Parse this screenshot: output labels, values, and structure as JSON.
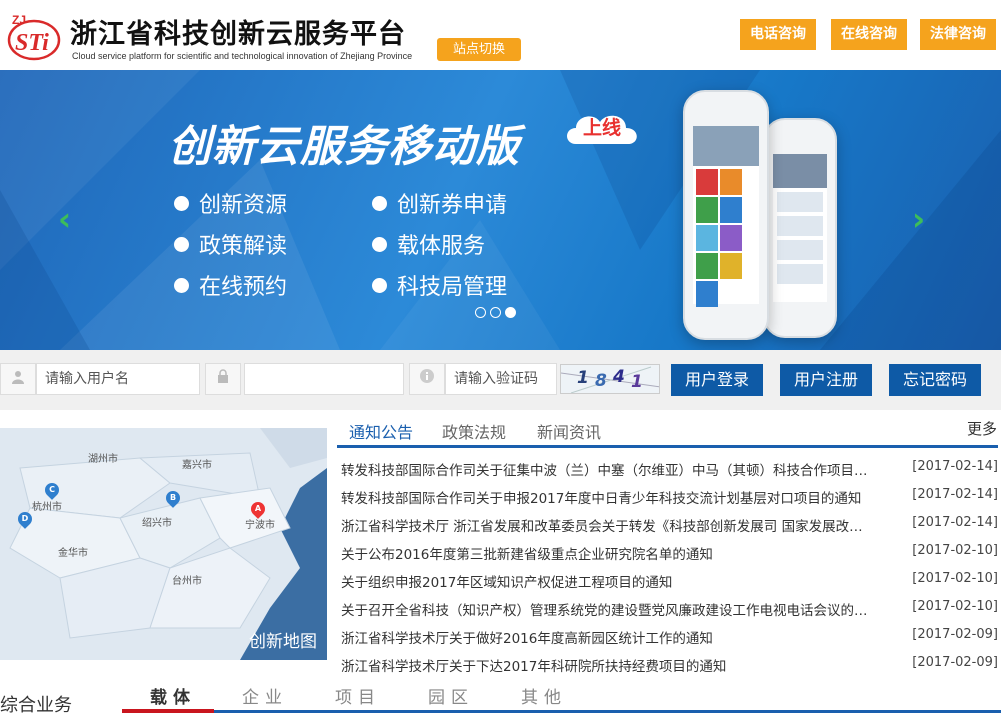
{
  "header": {
    "logo_letters": "ZJ STi",
    "title": "浙江省科技创新云服务平台",
    "subtitle": "Cloud service platform for scientific and technological innovation of Zhejiang Province",
    "switch_label": "站点切换",
    "buttons": [
      "电话咨询",
      "在线咨询",
      "法律咨询"
    ],
    "accent_color": "#f5a31d"
  },
  "banner": {
    "title": "创新云服务移动版",
    "badge": "上线",
    "features_left": [
      "创新资源",
      "政策解读",
      "在线预约"
    ],
    "features_right": [
      "创新券申请",
      "载体服务",
      "科技局管理"
    ],
    "prev_icon": "chevron-left-icon",
    "next_icon": "chevron-right-icon",
    "slides": 3,
    "active_slide": 3
  },
  "login": {
    "username_placeholder": "请输入用户名",
    "password_placeholder": "",
    "captcha_placeholder": "请输入验证码",
    "captcha_text": [
      "1",
      "8",
      "4",
      "1"
    ],
    "login_label": "用户登录",
    "register_label": "用户注册",
    "forgot_label": "忘记密码"
  },
  "map": {
    "label": "创新地图",
    "cities": [
      "湖州市",
      "嘉兴市",
      "杭州市",
      "绍兴市",
      "宁波市",
      "金华市",
      "台州市"
    ],
    "pins": [
      "A",
      "B",
      "C",
      "D"
    ]
  },
  "news": {
    "tabs": [
      "通知公告",
      "政策法规",
      "新闻资讯"
    ],
    "active_tab": 0,
    "more": "更多",
    "items": [
      {
        "title": "转发科技部国际合作司关于征集中波（兰）中塞（尔维亚）中马（其顿）科技合作项目的通知",
        "date": "[2017-02-14]"
      },
      {
        "title": "转发科技部国际合作司关于申报2017年度中日青少年科技交流计划基层对口项目的通知",
        "date": "[2017-02-14]"
      },
      {
        "title": "浙江省科学技术厅 浙江省发展和改革委员会关于转发《科技部创新发展司 国家发展改革委》的通知",
        "date": "[2017-02-14]"
      },
      {
        "title": "关于公布2016年度第三批新建省级重点企业研究院名单的通知",
        "date": "[2017-02-10]"
      },
      {
        "title": "关于组织申报2017年区域知识产权促进工程项目的通知",
        "date": "[2017-02-10]"
      },
      {
        "title": "关于召开全省科技（知识产权）管理系统党的建设暨党风廉政建设工作电视电话会议的通知",
        "date": "[2017-02-10]"
      },
      {
        "title": "浙江省科学技术厅关于做好2016年度高新园区统计工作的通知",
        "date": "[2017-02-09]"
      },
      {
        "title": "浙江省科学技术厅关于下达2017年科研院所扶持经费项目的通知",
        "date": "[2017-02-09]"
      }
    ]
  },
  "bottom": {
    "section_title": "综合业务",
    "tabs": [
      "载体",
      "企业",
      "项目",
      "园区",
      "其他"
    ],
    "active_tab": 0
  }
}
